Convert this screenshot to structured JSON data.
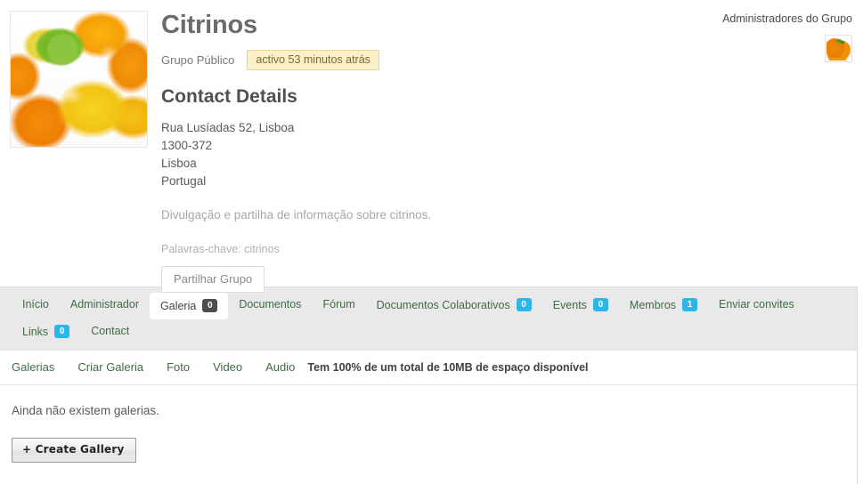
{
  "group": {
    "title": "Citrinos",
    "visibility": "Grupo Público",
    "activity_badge": "activo 53 minutos atrás",
    "contact_heading": "Contact Details",
    "address": [
      "Rua Lusíadas 52, Lisboa",
      "1300-372",
      "Lisboa",
      "Portugal"
    ],
    "description": "Divulgação e partilha de informação sobre citrinos.",
    "keywords": "Palavras-chave: citrinos",
    "share_button": "Partilhar Grupo",
    "avatar_icon": "citrus-fruits-photo"
  },
  "admins": {
    "title": "Administradores do Grupo",
    "members": [
      {
        "avatar_icon": "oranges-avatar"
      }
    ]
  },
  "tabs": [
    {
      "label": "Início",
      "count": null,
      "active": false
    },
    {
      "label": "Administrador",
      "count": null,
      "active": false
    },
    {
      "label": "Galeria",
      "count": "0",
      "active": true
    },
    {
      "label": "Documentos",
      "count": null,
      "active": false
    },
    {
      "label": "Fórum",
      "count": null,
      "active": false
    },
    {
      "label": "Documentos Colaborativos",
      "count": "0",
      "active": false
    },
    {
      "label": "Events",
      "count": "0",
      "active": false
    },
    {
      "label": "Membros",
      "count": "1",
      "active": false
    },
    {
      "label": "Enviar convites",
      "count": null,
      "active": false
    },
    {
      "label": "Links",
      "count": "0",
      "active": false
    },
    {
      "label": "Contact",
      "count": null,
      "active": false
    }
  ],
  "subnav": {
    "links": [
      {
        "label": "Galerias"
      },
      {
        "label": "Criar Galeria"
      },
      {
        "label": "Foto"
      },
      {
        "label": "Video"
      },
      {
        "label": "Audio"
      }
    ],
    "storage_note": "Tem 100% de um total de 10MB de espaço disponível"
  },
  "content": {
    "empty_message": "Ainda não existem galerias.",
    "create_gallery_button": "+ Create Gallery"
  },
  "colors": {
    "accent_green": "#3f6b43",
    "badge_blue": "#29b6e8",
    "badge_dark": "#4d4d4d",
    "activity_badge_bg": "#fcf0c8",
    "tabbar_bg": "#e9e9e9"
  }
}
